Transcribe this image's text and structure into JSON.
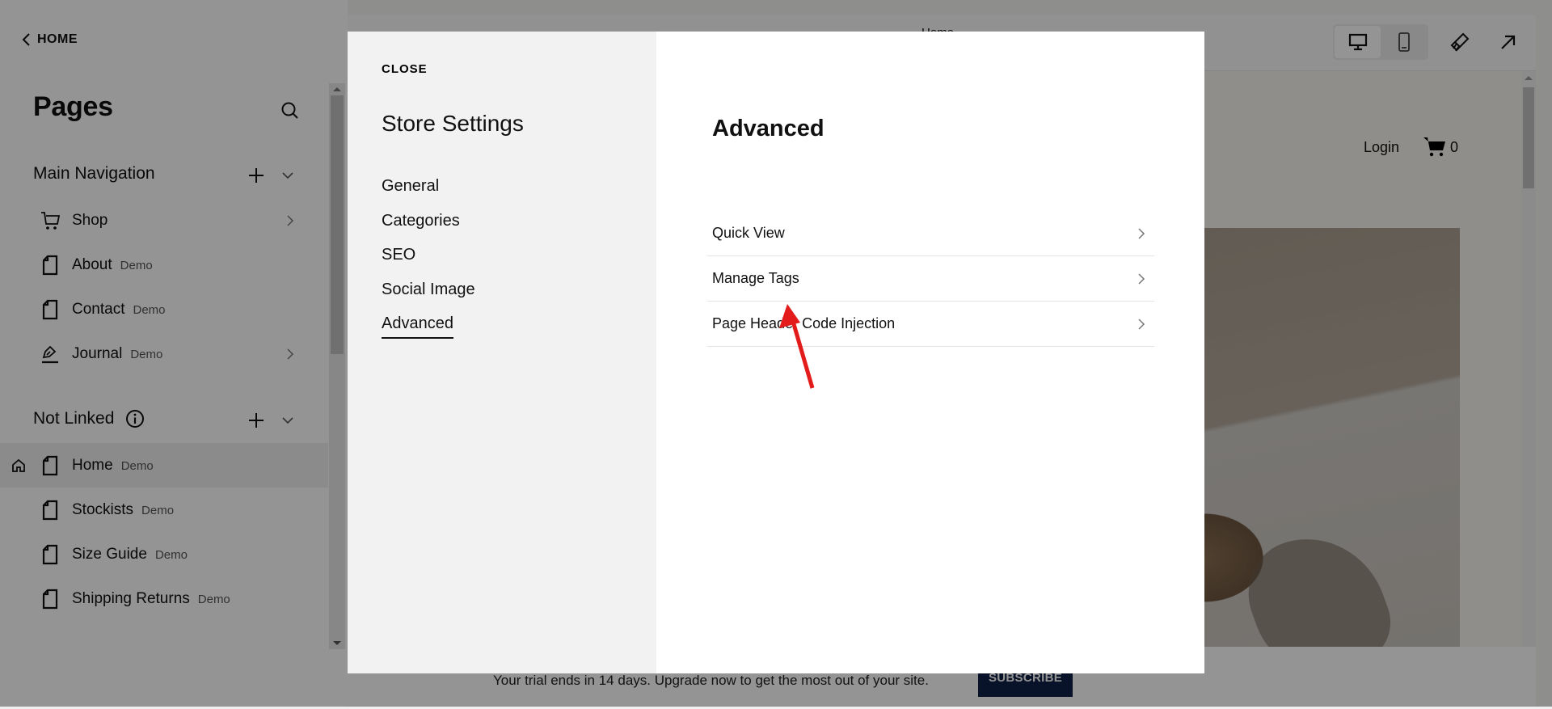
{
  "sidebar": {
    "back_label": "HOME",
    "title": "Pages",
    "sections": [
      {
        "title": "Main Navigation",
        "items": [
          {
            "label": "Shop",
            "tag": "",
            "icon": "cart-icon",
            "has_arrow": true
          },
          {
            "label": "About",
            "tag": "Demo",
            "icon": "page-icon",
            "has_arrow": false
          },
          {
            "label": "Contact",
            "tag": "Demo",
            "icon": "page-icon",
            "has_arrow": false
          },
          {
            "label": "Journal",
            "tag": "Demo",
            "icon": "blog-icon",
            "has_arrow": true
          }
        ]
      },
      {
        "title": "Not Linked",
        "items": [
          {
            "label": "Home",
            "tag": "Demo",
            "icon": "page-icon",
            "is_homepage": true,
            "active": true
          },
          {
            "label": "Stockists",
            "tag": "Demo",
            "icon": "page-icon"
          },
          {
            "label": "Size Guide",
            "tag": "Demo",
            "icon": "page-icon"
          },
          {
            "label": "Shipping Returns",
            "tag": "Demo",
            "icon": "page-icon"
          }
        ]
      }
    ]
  },
  "preview": {
    "page_name": "Home",
    "device_modes": [
      "desktop",
      "mobile"
    ],
    "selected_device": "desktop",
    "site_nav": {
      "login": "Login",
      "cart_count": "0"
    }
  },
  "trial_banner": {
    "message": "Your trial ends in 14 days. Upgrade now to get the most out of your site.",
    "button": "SUBSCRIBE",
    "button_color": "#0e1f45"
  },
  "modal": {
    "close_label": "CLOSE",
    "title": "Store Settings",
    "nav": [
      "General",
      "Categories",
      "SEO",
      "Social Image",
      "Advanced"
    ],
    "active_nav": "Advanced",
    "panel_title": "Advanced",
    "settings": [
      "Quick View",
      "Manage Tags",
      "Page Header Code Injection"
    ]
  },
  "annotation": {
    "type": "arrow",
    "color": "#e31b1b",
    "points_to": "Page Header Code Injection"
  }
}
